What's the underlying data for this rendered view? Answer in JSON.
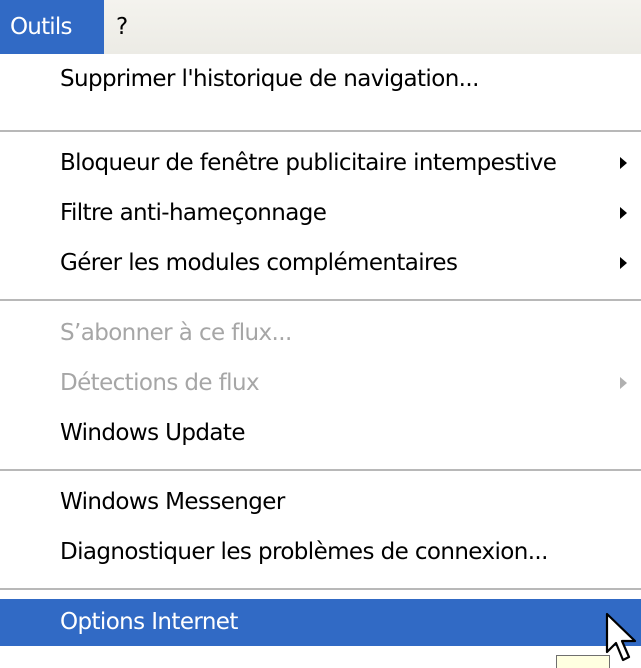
{
  "menubar": {
    "items": [
      {
        "label": "Outils"
      },
      {
        "label": "?"
      }
    ]
  },
  "menu": {
    "items": [
      {
        "label": "Supprimer l'historique de navigation..."
      },
      {
        "label": "Bloqueur de fenêtre publicitaire intempestive"
      },
      {
        "label": "Filtre anti-hameçonnage"
      },
      {
        "label": "Gérer les modules complémentaires"
      },
      {
        "label": "S’abonner à ce flux..."
      },
      {
        "label": "Détections de flux"
      },
      {
        "label": "Windows Update"
      },
      {
        "label": "Windows Messenger"
      },
      {
        "label": "Diagnostiquer les problèmes de connexion..."
      },
      {
        "label": "Options Internet"
      }
    ]
  },
  "icons": {
    "submenu_arrow": "chevron-right-icon",
    "cursor": "mouse-pointer-icon"
  },
  "colors": {
    "highlight": "#316ac5",
    "highlight_text": "#ffffff",
    "disabled_text": "#a6a6a6",
    "menubar_bg": "#ecebe5"
  }
}
